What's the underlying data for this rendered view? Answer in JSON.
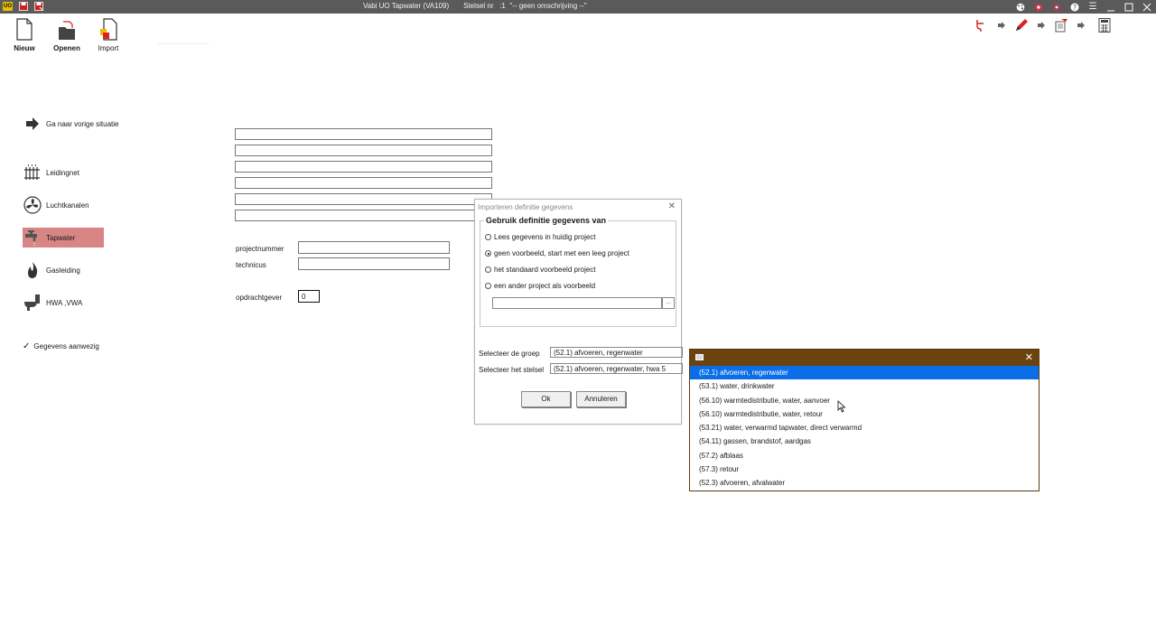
{
  "titlebar": {
    "title": "Vabi UO Tapwater (VA109)",
    "stelsel_label": "Stelsel nr",
    "stelsel_value": ":1",
    "description": "\"-- geen omschrijving --\"",
    "app_badge": "UO"
  },
  "toolbar": {
    "new_label": "Nieuw",
    "open_label": "Openen",
    "import_label": "Import"
  },
  "nav": {
    "back": "Ga naar vorige situatie",
    "items": [
      {
        "label": "Leidingnet",
        "icon": "radiator-icon"
      },
      {
        "label": "Luchtkanalen",
        "icon": "fan-icon"
      },
      {
        "label": "Tapwater",
        "icon": "faucet-icon"
      },
      {
        "label": "Gasleiding",
        "icon": "flame-icon"
      },
      {
        "label": "HWA ,VWA",
        "icon": "toilet-icon"
      }
    ],
    "data_present": "Gegevens aanwezig",
    "active_color": "#d88585"
  },
  "form": {
    "projectnummer_label": "projectnummer",
    "technicus_label": "technicus",
    "opdrachtgever_label": "opdrachtgever",
    "opdrachtgever_value": "0"
  },
  "dialog": {
    "title": "Importeren definitie gegevens",
    "group_title": "Gebruik definitie gegevens van",
    "options": [
      "Lees gegevens in huidig project",
      "geen voorbeeld, start met een leeg project",
      "het standaard voorbeeld project",
      "een ander project als voorbeeld"
    ],
    "selected_option": 1,
    "browse_label": "...",
    "group_label": "Selecteer de groep",
    "group_value": "(52.1) afvoeren, regenwater",
    "stelsel_label": "Selecteer het stelsel",
    "stelsel_value": "(52.1) afvoeren, regenwater, hwa 5",
    "ok_label": "Ok",
    "cancel_label": "Annuleren"
  },
  "dropdown": {
    "header_color": "#6b4310",
    "selected_color": "#0a6ee6",
    "items": [
      "(52.1) afvoeren, regenwater",
      "(53.1) water, drinkwater",
      "(56.10) warmtedistributie, water, aanvoer",
      "(56.10) warmtedistributie, water, retour",
      "(53.21) water, verwarmd tapwater, direct verwarmd",
      "(54.11) gassen, brandstof, aardgas",
      "(57.2) afblaas",
      "(57.3) retour",
      "(52.3) afvoeren, afvalwater"
    ],
    "selected_index": 0
  }
}
